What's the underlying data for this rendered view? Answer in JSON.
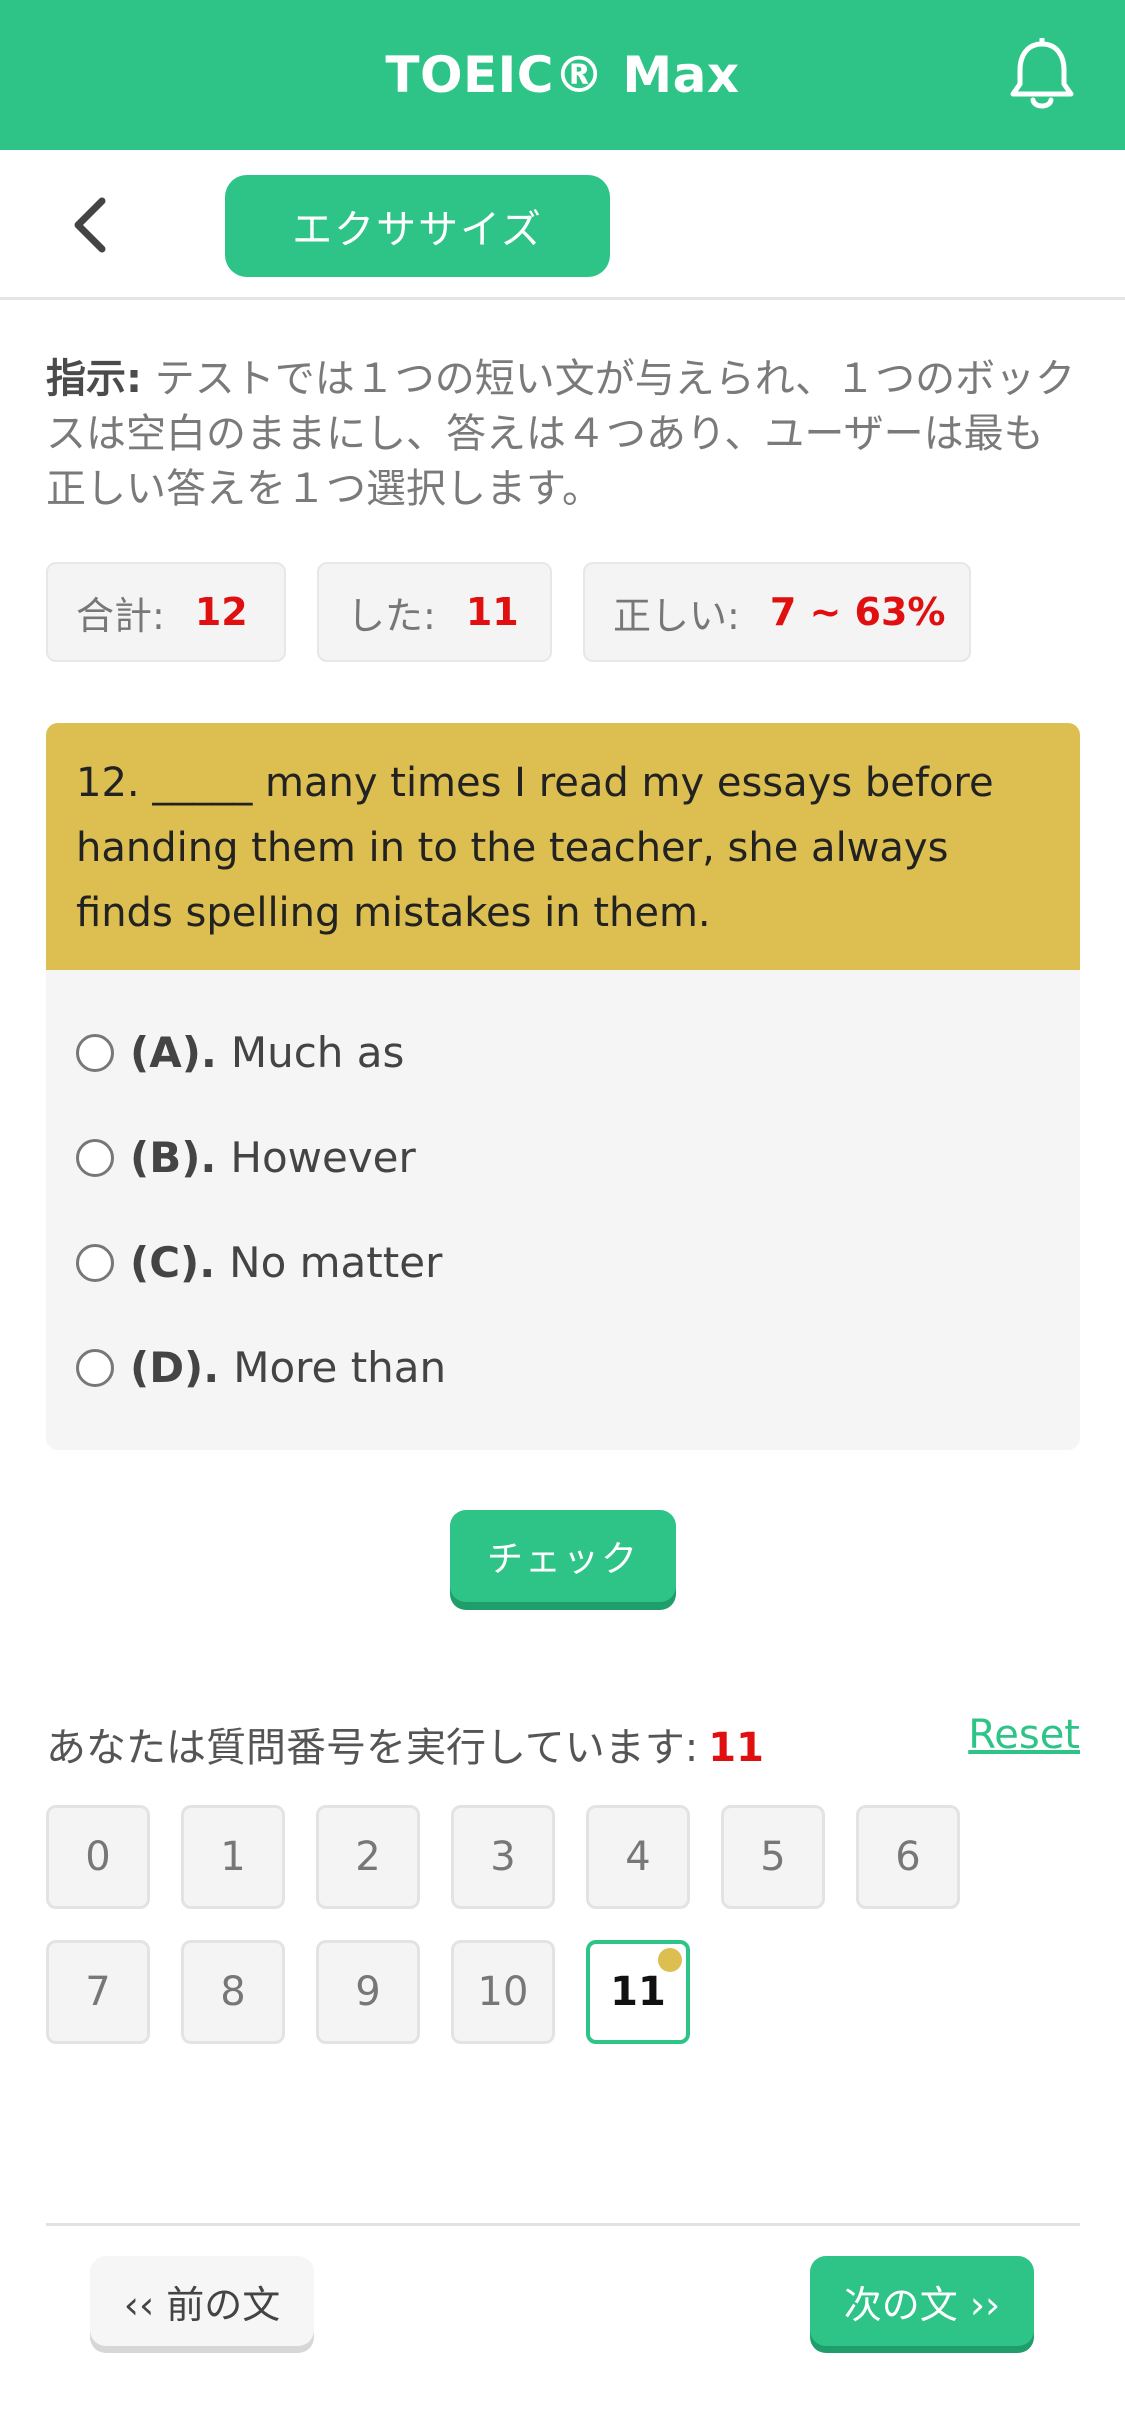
{
  "header": {
    "title": "TOEIC® Max",
    "bell_icon": "bell-icon",
    "color": "#2ec487"
  },
  "subbar": {
    "back_icon": "chevron-left-icon",
    "tab_label": "エクササイズ"
  },
  "instructions": {
    "label": "指示:",
    "text": " テストでは１つの短い文が与えられ、１つのボックスは空白のままにし、答えは４つあり、ユーザーは最も正しい答えを１つ選択します。"
  },
  "stats": {
    "total_label": "合計:",
    "total_value": "12",
    "done_label": "した:",
    "done_value": "11",
    "correct_label": "正しい:",
    "correct_value": "7 ~ 63%"
  },
  "question": {
    "text": "12. _____ many times I read my essays before handing them in to the teacher, she always finds spelling mistakes in them.",
    "header_color": "#dcbf50",
    "options": [
      {
        "letter": "(A).",
        "text": "Much as"
      },
      {
        "letter": "(B).",
        "text": "However"
      },
      {
        "letter": "(C).",
        "text": "No matter"
      },
      {
        "letter": "(D).",
        "text": "More than"
      }
    ]
  },
  "check_label": "チェック",
  "running": {
    "label": "あなたは質問番号を実行しています:",
    "number": "11",
    "reset_label": "Reset"
  },
  "grid": {
    "numbers": [
      "0",
      "1",
      "2",
      "3",
      "4",
      "5",
      "6",
      "7",
      "8",
      "9",
      "10",
      "11"
    ],
    "current": "11"
  },
  "nav": {
    "prev_label": "‹‹ 前の文",
    "next_label": "次の文 ››"
  }
}
